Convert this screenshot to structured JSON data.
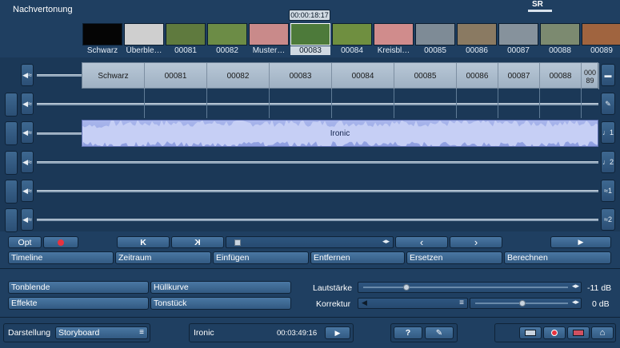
{
  "window": {
    "title": "Nachvertonung",
    "badge": "SR",
    "timecode": "00:00:18:17"
  },
  "thumbnails": [
    {
      "label": "Schwarz",
      "color": "#050505"
    },
    {
      "label": "Überble…",
      "color": "#cfcfcf"
    },
    {
      "label": "00081",
      "color": "#5f7a3e"
    },
    {
      "label": "00082",
      "color": "#6c8c46"
    },
    {
      "label": "Muster…",
      "color": "#c98a8a"
    },
    {
      "label": "00083",
      "color": "#4d7a3a",
      "selected": true
    },
    {
      "label": "00084",
      "color": "#6f8f40"
    },
    {
      "label": "Kreisbl…",
      "color": "#d08c8c"
    },
    {
      "label": "00085",
      "color": "#7e8b96"
    },
    {
      "label": "00086",
      "color": "#8a7a62"
    },
    {
      "label": "00087",
      "color": "#86929c"
    },
    {
      "label": "00088",
      "color": "#7c8a70"
    },
    {
      "label": "00089",
      "color": "#a0643f"
    }
  ],
  "video_track": {
    "clips": [
      "Schwarz",
      "00081",
      "00082",
      "00083",
      "00084",
      "00085",
      "00086",
      "00087",
      "00088",
      "00089"
    ]
  },
  "audio_track": {
    "label": "Ironic"
  },
  "side_labels": {
    "t3": "♩1",
    "t4": "♩2",
    "t5": "≈1",
    "t6": "≈2"
  },
  "transport": {
    "opt": "Opt",
    "start_icon": "K",
    "end_icon": "K",
    "prev_icon": "‹",
    "next_icon": "›",
    "play_icon": "▶"
  },
  "menu": [
    "Timeline",
    "Zeitraum",
    "Einfügen",
    "Entfernen",
    "Ersetzen",
    "Berechnen"
  ],
  "controls": {
    "tonblende": "Tonblende",
    "huellkurve": "Hüllkurve",
    "effekte": "Effekte",
    "tonstueck": "Tonstück",
    "lautstaerke_label": "Lautstärke",
    "lautstaerke_value": "-11 dB",
    "lautstaerke_level": 0.2,
    "korrektur_label": "Korrektur",
    "korrektur_value": "0 dB",
    "korrektur_level": 0.5
  },
  "footer": {
    "darstellung_label": "Darstellung",
    "darstellung_value": "Storyboard",
    "clip_name": "Ironic",
    "clip_duration": "00:03:49:16",
    "help_label": "?"
  }
}
